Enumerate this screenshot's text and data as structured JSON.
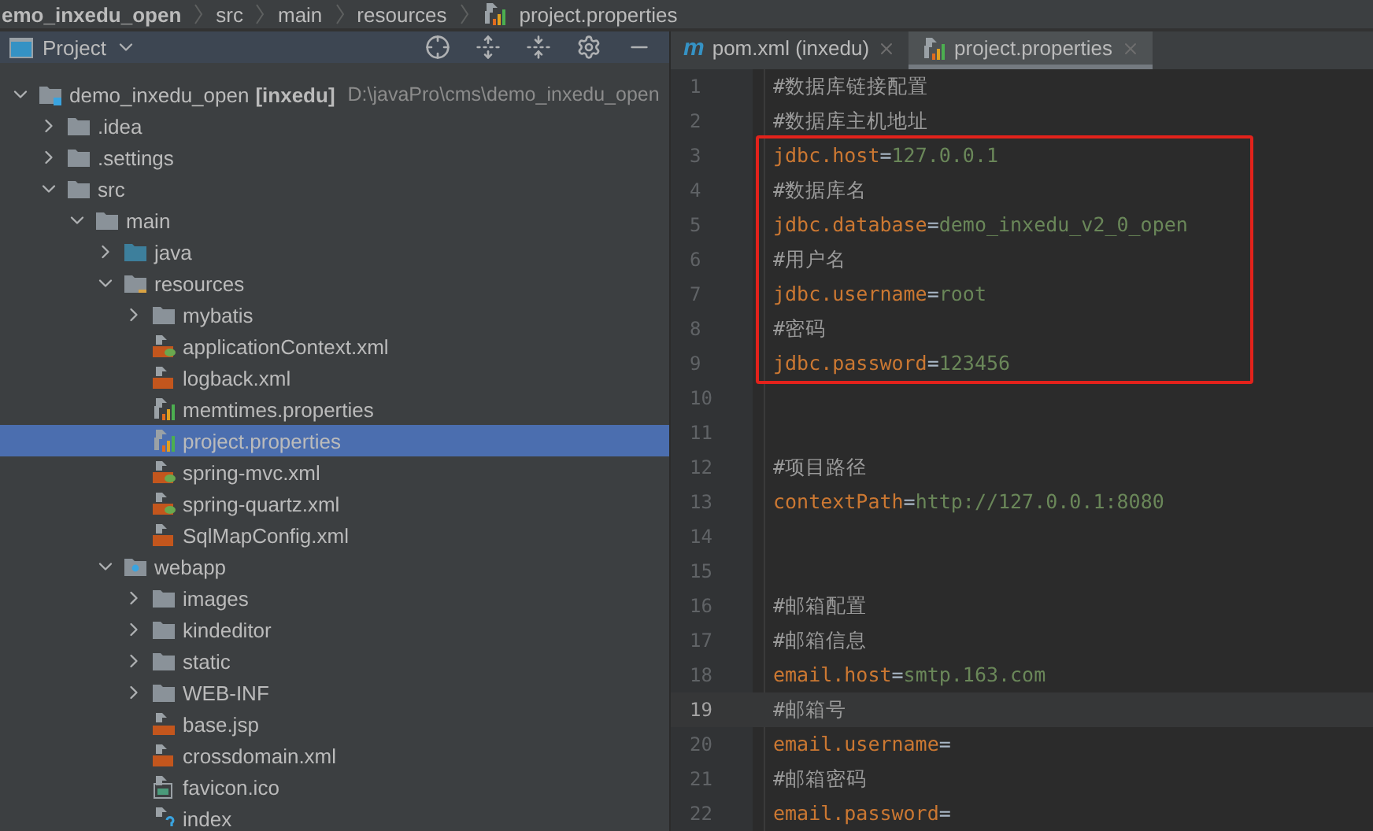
{
  "breadcrumb": [
    {
      "label": "emo_inxedu_open",
      "kind": "project"
    },
    {
      "label": "src",
      "kind": "folder"
    },
    {
      "label": "main",
      "kind": "folder"
    },
    {
      "label": "resources",
      "kind": "folder"
    },
    {
      "label": "project.properties",
      "kind": "properties"
    }
  ],
  "project_panel": {
    "title": "Project",
    "tree": [
      {
        "name": "demo_inxedu_open",
        "module": "[inxedu]",
        "path": "D:\\javaPro\\cms\\demo_inxedu_open",
        "kind": "module",
        "expanded": true,
        "selected": false,
        "children": [
          {
            "name": ".idea",
            "kind": "folder",
            "expanded": false,
            "selected": false
          },
          {
            "name": ".settings",
            "kind": "folder",
            "expanded": false,
            "selected": false
          },
          {
            "name": "src",
            "kind": "folder",
            "expanded": true,
            "selected": false,
            "children": [
              {
                "name": "main",
                "kind": "folder",
                "expanded": true,
                "selected": false,
                "children": [
                  {
                    "name": "java",
                    "kind": "source",
                    "expanded": false,
                    "selected": false
                  },
                  {
                    "name": "resources",
                    "kind": "resources",
                    "expanded": true,
                    "selected": false,
                    "children": [
                      {
                        "name": "mybatis",
                        "kind": "folder",
                        "expanded": false,
                        "selected": false
                      },
                      {
                        "name": "applicationContext.xml",
                        "kind": "spring",
                        "selected": false
                      },
                      {
                        "name": "logback.xml",
                        "kind": "xml",
                        "selected": false
                      },
                      {
                        "name": "memtimes.properties",
                        "kind": "properties",
                        "selected": false
                      },
                      {
                        "name": "project.properties",
                        "kind": "properties",
                        "selected": true
                      },
                      {
                        "name": "spring-mvc.xml",
                        "kind": "spring",
                        "selected": false
                      },
                      {
                        "name": "spring-quartz.xml",
                        "kind": "spring",
                        "selected": false
                      },
                      {
                        "name": "SqlMapConfig.xml",
                        "kind": "xml",
                        "selected": false
                      }
                    ]
                  },
                  {
                    "name": "webapp",
                    "kind": "web",
                    "expanded": true,
                    "selected": false,
                    "children": [
                      {
                        "name": "images",
                        "kind": "folder",
                        "expanded": false,
                        "selected": false
                      },
                      {
                        "name": "kindeditor",
                        "kind": "folder",
                        "expanded": false,
                        "selected": false
                      },
                      {
                        "name": "static",
                        "kind": "folder",
                        "expanded": false,
                        "selected": false
                      },
                      {
                        "name": "WEB-INF",
                        "kind": "folder",
                        "expanded": false,
                        "selected": false
                      },
                      {
                        "name": "base.jsp",
                        "kind": "jsp",
                        "selected": false
                      },
                      {
                        "name": "crossdomain.xml",
                        "kind": "xml",
                        "selected": false
                      },
                      {
                        "name": "favicon.ico",
                        "kind": "image",
                        "selected": false
                      },
                      {
                        "name": "index",
                        "kind": "unknown",
                        "selected": false
                      }
                    ]
                  }
                ]
              }
            ]
          }
        ]
      }
    ]
  },
  "editor": {
    "tabs": [
      {
        "label": "pom.xml (inxedu)",
        "icon_glyph": "m",
        "kind": "maven",
        "selected": false
      },
      {
        "label": "project.properties",
        "kind": "properties",
        "selected": true
      }
    ],
    "lines": [
      {
        "number": "1",
        "kind": "comment",
        "text": "#数据库链接配置",
        "boxed": false,
        "current": false
      },
      {
        "number": "2",
        "kind": "comment",
        "text": "#数据库主机地址",
        "boxed": false,
        "current": false
      },
      {
        "number": "3",
        "kind": "property",
        "key": "jdbc.host",
        "sep": "=",
        "value": "127.0.0.1",
        "boxed": true,
        "current": false
      },
      {
        "number": "4",
        "kind": "comment",
        "text": "#数据库名",
        "boxed": true,
        "current": false
      },
      {
        "number": "5",
        "kind": "property",
        "key": "jdbc.database",
        "sep": "=",
        "value": "demo_inxedu_v2_0_open",
        "boxed": true,
        "current": false
      },
      {
        "number": "6",
        "kind": "comment",
        "text": "#用户名",
        "boxed": true,
        "current": false
      },
      {
        "number": "7",
        "kind": "property",
        "key": "jdbc.username",
        "sep": "=",
        "value": "root",
        "boxed": true,
        "current": false
      },
      {
        "number": "8",
        "kind": "comment",
        "text": "#密码",
        "boxed": true,
        "current": false
      },
      {
        "number": "9",
        "kind": "property",
        "key": "jdbc.password",
        "sep": "=",
        "value": "123456",
        "boxed": true,
        "current": false
      },
      {
        "number": "10",
        "kind": "blank",
        "boxed": false,
        "current": false
      },
      {
        "number": "11",
        "kind": "blank",
        "boxed": false,
        "current": false
      },
      {
        "number": "12",
        "kind": "comment",
        "text": "#项目路径",
        "boxed": false,
        "current": false
      },
      {
        "number": "13",
        "kind": "property",
        "key": "contextPath",
        "sep": "=",
        "value": "http://127.0.0.1:8080",
        "boxed": false,
        "current": false
      },
      {
        "number": "14",
        "kind": "blank",
        "boxed": false,
        "current": false
      },
      {
        "number": "15",
        "kind": "blank",
        "boxed": false,
        "current": false
      },
      {
        "number": "16",
        "kind": "comment",
        "text": "#邮箱配置",
        "boxed": false,
        "current": false
      },
      {
        "number": "17",
        "kind": "comment",
        "text": "#邮箱信息",
        "boxed": false,
        "current": false
      },
      {
        "number": "18",
        "kind": "property",
        "key": "email.host",
        "sep": "=",
        "value": "smtp.163.com",
        "boxed": false,
        "current": false
      },
      {
        "number": "19",
        "kind": "comment",
        "text": "#邮箱号",
        "boxed": false,
        "current": true
      },
      {
        "number": "20",
        "kind": "property",
        "key": "email.username",
        "sep": "=",
        "boxed": false,
        "current": false
      },
      {
        "number": "21",
        "kind": "comment",
        "text": "#邮箱密码",
        "boxed": false,
        "current": false
      },
      {
        "number": "22",
        "kind": "property",
        "key": "email.password",
        "sep": "=",
        "boxed": false,
        "current": false
      }
    ]
  }
}
